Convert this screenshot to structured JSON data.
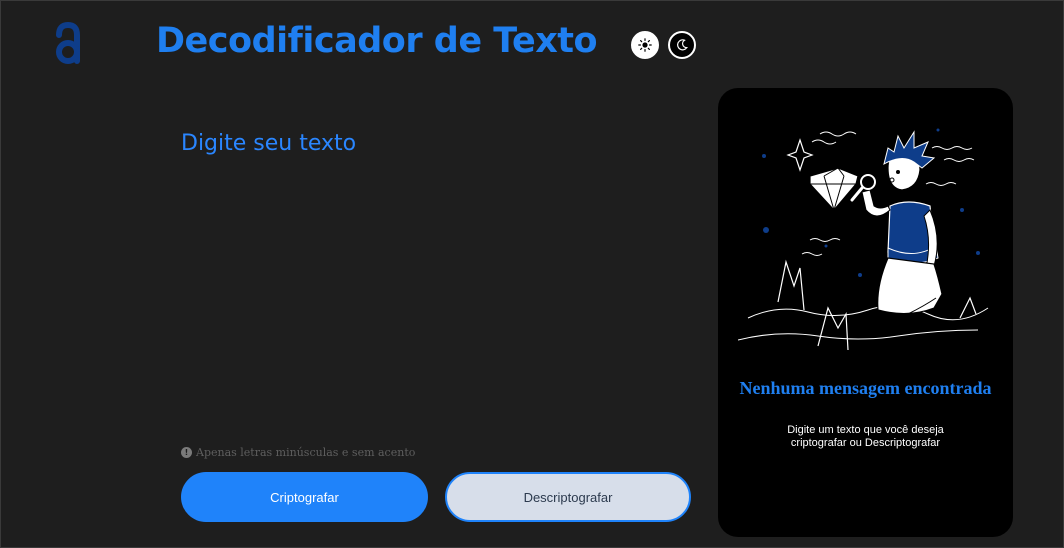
{
  "header": {
    "title": "Decodificador de Texto",
    "logo_icon": "alura-logo-icon",
    "theme_light_icon": "sun-icon",
    "theme_dark_icon": "moon-icon"
  },
  "input": {
    "placeholder": "Digite seu texto",
    "value": ""
  },
  "hint": {
    "icon": "info-icon",
    "text": "Apenas letras minúsculas e sem acento"
  },
  "buttons": {
    "encrypt_label": "Criptografar",
    "decrypt_label": "Descriptografar"
  },
  "output": {
    "title": "Nenhuma mensagem encontrada",
    "subtitle": "Digite um texto que você deseja criptografar ou Descriptografar",
    "illustration_icon": "boy-with-magnifier-illustration"
  },
  "colors": {
    "accent": "#1f7ff0",
    "background": "#1e1e1e",
    "panel": "#000000",
    "decrypt_bg": "#d7deea"
  }
}
